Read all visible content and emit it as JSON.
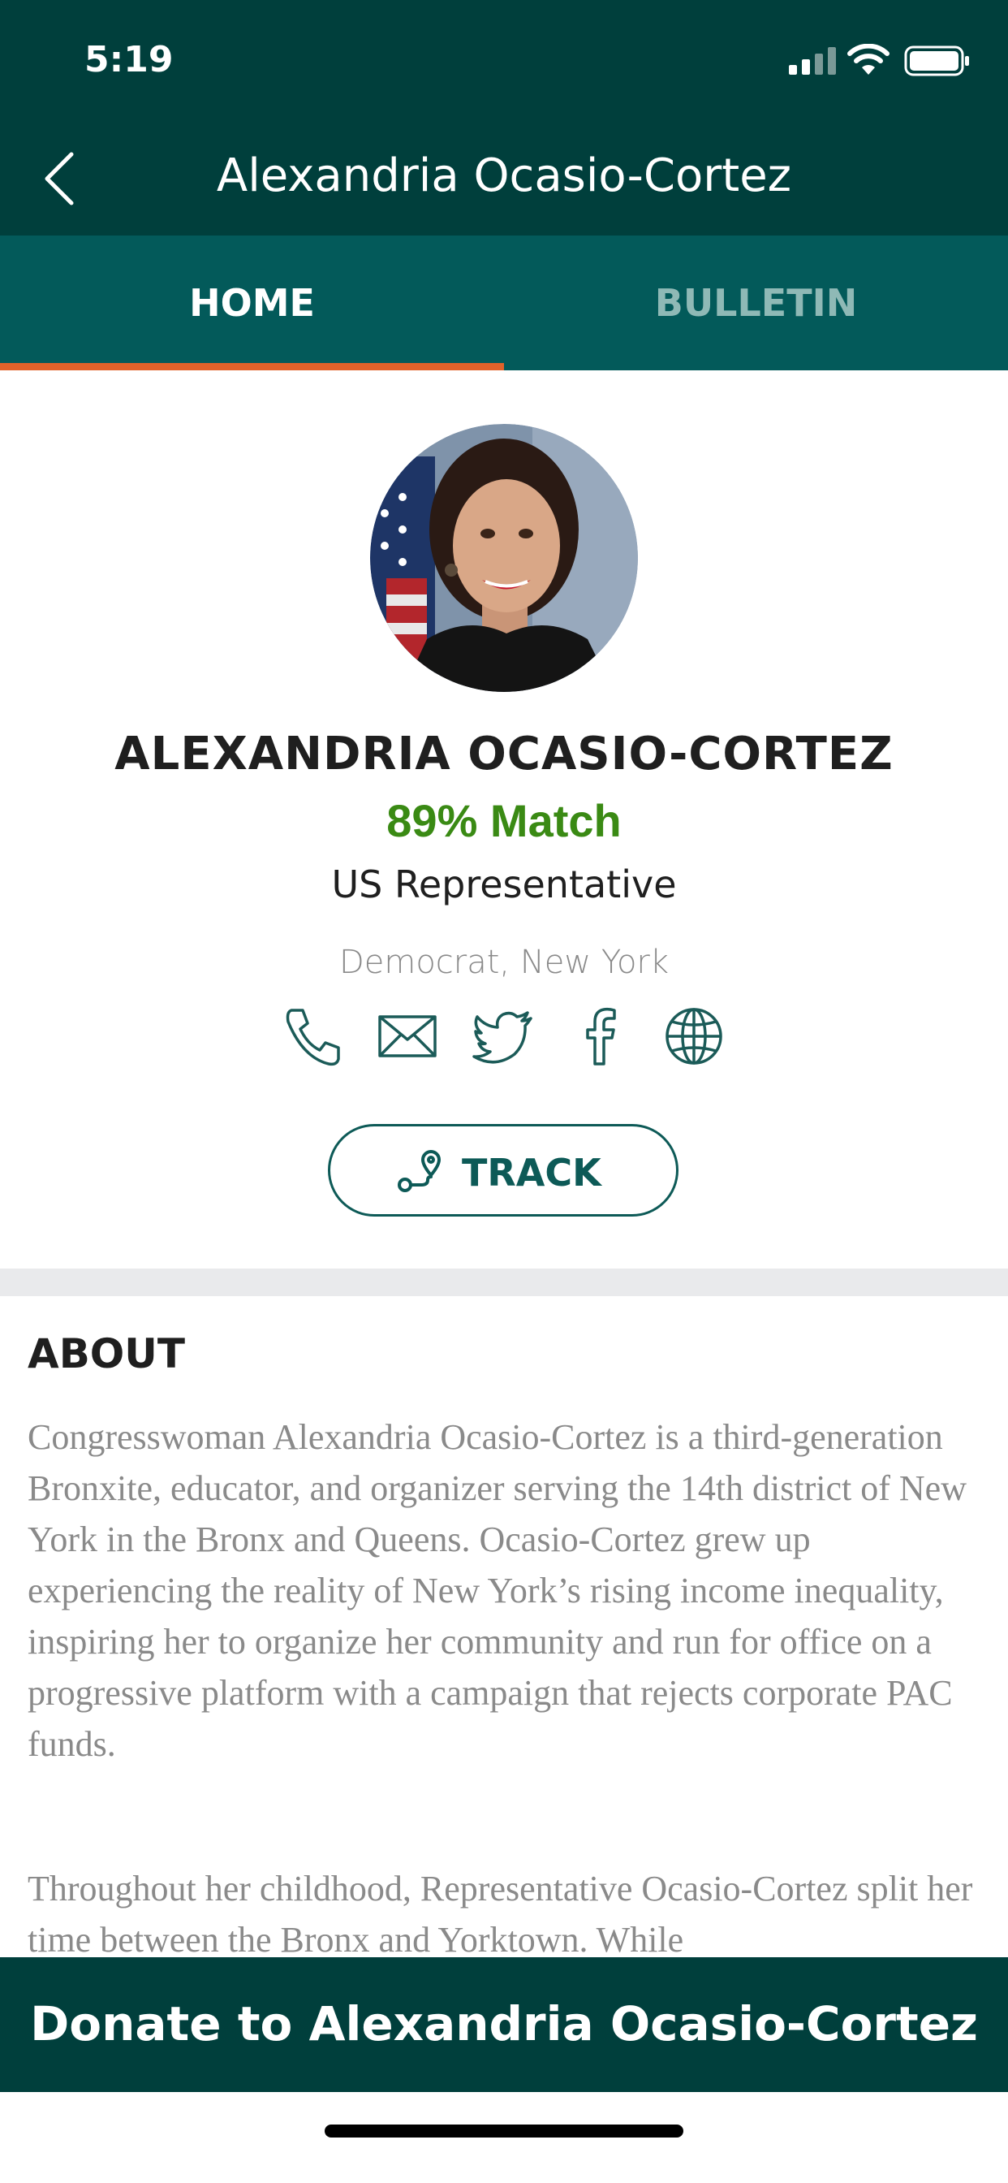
{
  "status_bar": {
    "time": "5:19"
  },
  "nav": {
    "title": "Alexandria Ocasio-Cortez",
    "back_icon": "chevron-left-icon"
  },
  "tabs": [
    {
      "label": "HOME",
      "active": true
    },
    {
      "label": "BULLETIN",
      "active": false
    }
  ],
  "profile": {
    "name": "ALEXANDRIA OCASIO-CORTEZ",
    "match": "89% Match",
    "office": "US Representative",
    "party_state": "Democrat, New York",
    "contact_icons": [
      "phone-icon",
      "mail-icon",
      "twitter-icon",
      "facebook-icon",
      "globe-icon"
    ],
    "track_label": "TRACK"
  },
  "about": {
    "title": "ABOUT",
    "paragraphs": [
      "Congresswoman Alexandria Ocasio-Cortez is a third-generation Bronxite, educator, and organizer serving the 14th district of New York in the Bronx and Queens. Ocasio-Cortez grew up experiencing the reality of New York’s rising income inequality, inspiring her to organize her community and run for office on a progressive platform with a campaign that rejects corporate PAC funds.",
      "Throughout her childhood, Representative Ocasio-Cortez split her time between the Bronx and Yorktown. While"
    ]
  },
  "donate": {
    "label": "Donate to Alexandria Ocasio-Cortez"
  },
  "colors": {
    "header": "#003f3c",
    "tab_bar": "#035a5a",
    "tab_indicator": "#e0622a",
    "accent": "#0d5a57",
    "match": "#3a8a14"
  }
}
